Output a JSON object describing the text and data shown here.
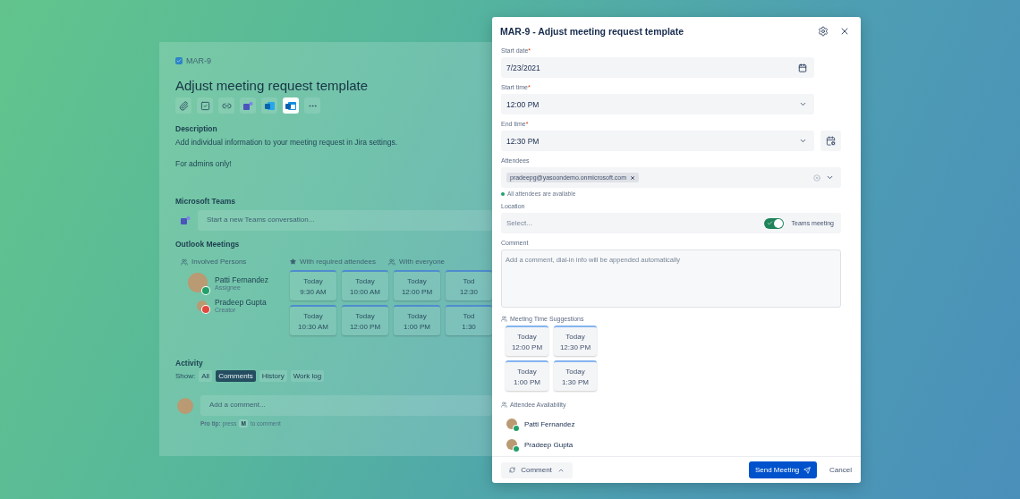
{
  "issue": {
    "key": "MAR-9",
    "title": "Adjust meeting request template",
    "toolbar": [
      {
        "kind": "attach",
        "selected": false
      },
      {
        "kind": "checklist",
        "selected": false
      },
      {
        "kind": "link",
        "selected": false
      },
      {
        "kind": "teams",
        "selected": false
      },
      {
        "kind": "outlook",
        "selected": false
      },
      {
        "kind": "meeting",
        "selected": true
      },
      {
        "kind": "more",
        "selected": false
      }
    ],
    "description": {
      "label": "Description",
      "paragraphs": [
        "Add individual information to your meeting request in Jira settings.",
        "For admins only!"
      ]
    },
    "teams": {
      "label": "Microsoft Teams",
      "placeholder": "Start a new Teams conversation..."
    },
    "outlook": {
      "label": "Outlook Meetings",
      "persons_header": "Involved Persons",
      "slot_headers": [
        {
          "kind": "star",
          "label": "With required attendees"
        },
        {
          "kind": "group",
          "label": "With everyone"
        }
      ],
      "persons": [
        {
          "name": "Patti Fernandez",
          "role": "Assignee",
          "color": "#22a06b"
        },
        {
          "name": "Pradeep Gupta",
          "role": "Creator",
          "color": "#e2483d"
        }
      ],
      "slots": [
        [
          {
            "day": "Today",
            "time": "9:30 AM"
          },
          {
            "day": "Today",
            "time": "10:00 AM"
          },
          {
            "day": "Today",
            "time": "12:00 PM"
          },
          {
            "day": "Tod",
            "time": "12:30"
          }
        ],
        [
          {
            "day": "Today",
            "time": "10:30 AM"
          },
          {
            "day": "Today",
            "time": "12:00 PM"
          },
          {
            "day": "Today",
            "time": "1:00 PM"
          },
          {
            "day": "Tod",
            "time": "1:30"
          }
        ]
      ]
    },
    "activity": {
      "label": "Activity",
      "show_label": "Show:",
      "filters": [
        {
          "label": "All",
          "selected": false
        },
        {
          "label": "Comments",
          "selected": true
        },
        {
          "label": "History",
          "selected": false
        },
        {
          "label": "Work log",
          "selected": false
        }
      ],
      "comment_placeholder": "Add a comment...",
      "tip": "**Pro tip:** press",
      "tip_key": "M",
      "tip_end": "to comment"
    }
  },
  "dialog": {
    "title": "MAR-9 - Adjust meeting request template",
    "start_date": {
      "label": "Start date",
      "required_mark": "*",
      "value": "7/23/2021"
    },
    "start_time": {
      "label": "Start time",
      "required_mark": "*",
      "value": "12:00 PM"
    },
    "end_time": {
      "label": "End time",
      "required_mark": "*",
      "value": "12:30 PM"
    },
    "attendees": {
      "label": "Attendees",
      "chips": [
        "pradeepg@yasoondemo.onmicrosoft.com"
      ],
      "status": "All attendees are available"
    },
    "location": {
      "label": "Location",
      "placeholder": "Select...",
      "teams_toggle": {
        "label": "Teams meeting",
        "on": true
      }
    },
    "comment": {
      "label": "Comment",
      "placeholder": "Add a comment, dial-in info will be appended automatically"
    },
    "suggestions": {
      "label": "Meeting Time Suggestions",
      "slots": [
        {
          "day": "Today",
          "time": "12:00 PM"
        },
        {
          "day": "Today",
          "time": "12:30 PM"
        },
        {
          "day": "Today",
          "time": "1:00 PM"
        },
        {
          "day": "Today",
          "time": "1:30 PM"
        }
      ]
    },
    "availability": {
      "label": "Attendee Availability",
      "persons": [
        {
          "name": "Patti Fernandez",
          "color": "#22a06b"
        },
        {
          "name": "Pradeep Gupta",
          "color": "#22a06b"
        }
      ]
    },
    "footer": {
      "comment_button": "Comment",
      "send_button": "Send Meeting",
      "cancel_button": "Cancel"
    }
  }
}
